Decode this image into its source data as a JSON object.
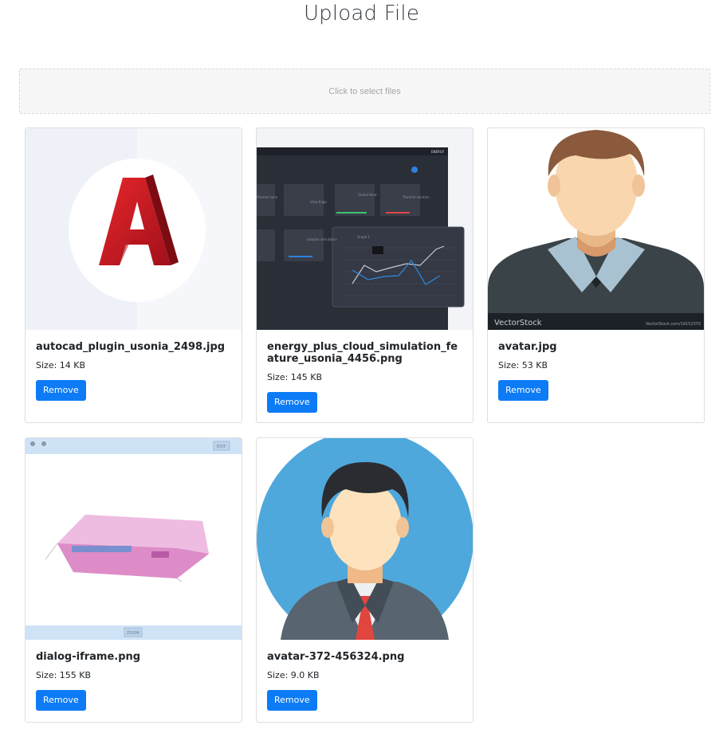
{
  "page": {
    "title": "Upload File"
  },
  "dropzone": {
    "label": "Click to select files"
  },
  "files": [
    {
      "name": "autocad_plugin_usonia_2498.jpg",
      "size": "Size: 14 KB",
      "remove": "Remove"
    },
    {
      "name": "energy_plus_cloud_simulation_feature_usonia_4456.png",
      "size": "Size: 145 KB",
      "remove": "Remove",
      "thumb_texts": [
        "Thermal zone",
        "View Edge",
        "Global Heat",
        "Thermal solution",
        "solution simulation",
        "Graph 1",
        "ENERGY"
      ]
    },
    {
      "name": "avatar.jpg",
      "size": "Size: 53 KB",
      "remove": "Remove",
      "watermark": "VectorStock",
      "watermark_url": "VectorStock.com/19152370"
    },
    {
      "name": "dialog-iframe.png",
      "size": "Size: 155 KB",
      "remove": "Remove",
      "thumb_texts": [
        "EXIT",
        "ZOOM"
      ]
    },
    {
      "name": "avatar-372-456324.png",
      "size": "Size: 9.0 KB",
      "remove": "Remove"
    }
  ],
  "colors": {
    "primary": "#0d7bf5",
    "autocad_red": "#c4161c",
    "avatar_blue": "#4fa8dc"
  }
}
